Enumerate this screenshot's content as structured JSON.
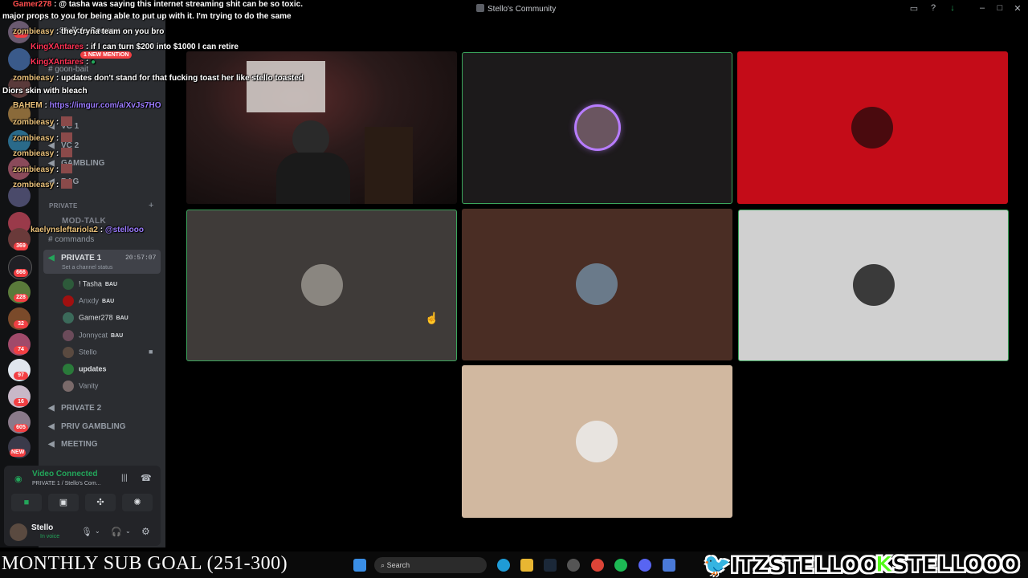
{
  "window": {
    "title": "Stello's Community"
  },
  "sidebar": {
    "server_name": "Stello's Commu",
    "mention_badge": "1 NEW MENTION",
    "channels": [
      "goon-bait"
    ],
    "voice_channels": [
      "VC 1",
      "VC 2",
      "GAMBLING",
      "BAG"
    ],
    "private_category": "PRIVATE",
    "mod_talk": "MOD-TALK",
    "commands": "commands",
    "active_channel": {
      "name": "PRIVATE 1",
      "timer": "20:57:07",
      "status": "Set a channel status"
    },
    "members": [
      {
        "name": "! Tasha",
        "tag": "BAU",
        "color": "#2d5a3a"
      },
      {
        "name": "Anxdy",
        "tag": "BAU",
        "color": "#a01010"
      },
      {
        "name": "Gamer278",
        "tag": "BAU",
        "color": "#3b6a5a"
      },
      {
        "name": "Jonnycat",
        "tag": "BAU",
        "color": "#6b4b5a"
      },
      {
        "name": "Stello",
        "tag": "",
        "color": "#5a4a40"
      },
      {
        "name": "updates",
        "tag": "",
        "color": "#2a7a3a"
      },
      {
        "name": "Vanity",
        "tag": "",
        "color": "#7a6a6a"
      }
    ],
    "more_voice_channels": [
      "PRIVATE 2",
      "PRIV GAMBLING",
      "MEETING"
    ],
    "voice_status": {
      "title": "Video Connected",
      "subtitle": "PRIVATE 1 / Stello's Com..."
    },
    "user": {
      "name": "Stello",
      "status": "In voice"
    }
  },
  "guild_badges": [
    "29",
    "369",
    "666",
    "228",
    "32",
    "74",
    "97",
    "16",
    "605",
    "NEW"
  ],
  "chat_overlay": [
    {
      "user": "Gamer278",
      "user_color": "#ff4d4d",
      "text": ": @ tasha was saying this internet streaming shit can be so toxic."
    },
    {
      "user": "",
      "user_color": "#ffffff",
      "text": "major props to you for being able to put up with it. I'm trying to do the same"
    },
    {
      "user": "zombieasy",
      "user_color": "#e8c07a",
      "text": ": they tryna team on you bro"
    },
    {
      "user": "KingXAntares",
      "user_color": "#ff3355",
      "text": ": if I can turn $200 into $1000 I can retire"
    },
    {
      "user": "KingXAntares",
      "user_color": "#ff3355",
      "text": ":"
    },
    {
      "user": "zombieasy",
      "user_color": "#e8c07a",
      "text": ": updates don't stand for that fucking toast her like stello toasted"
    },
    {
      "user": "",
      "user_color": "#ffffff",
      "text": "Diors skin with bleach"
    },
    {
      "user": "BAHEM",
      "user_color": "#e8c07a",
      "text": ":"
    },
    {
      "user": "",
      "user_color": "#9b7bff",
      "text": "https://imgur.com/a/XvJs7HO"
    },
    {
      "user": "zombieasy",
      "user_color": "#e8c07a",
      "text": ":"
    },
    {
      "user": "zombieasy",
      "user_color": "#e8c07a",
      "text": ":"
    },
    {
      "user": "zombieasy",
      "user_color": "#e8c07a",
      "text": ":"
    },
    {
      "user": "zombieasy",
      "user_color": "#e8c07a",
      "text": ":"
    },
    {
      "user": "zombieasy",
      "user_color": "#e8c07a",
      "text": ":"
    },
    {
      "user": "kaelynsleftariola2",
      "user_color": "#e8c07a",
      "text": ":"
    },
    {
      "user": "",
      "user_color": "#9b7bff",
      "text": "@stellooo"
    }
  ],
  "taskbar": {
    "search_placeholder": "Search",
    "sub_goal": "MONTHLY SUB GOAL (251-300)"
  },
  "socials": {
    "twitter": "ITZSTELLOO",
    "kick": "STELLOOO"
  }
}
